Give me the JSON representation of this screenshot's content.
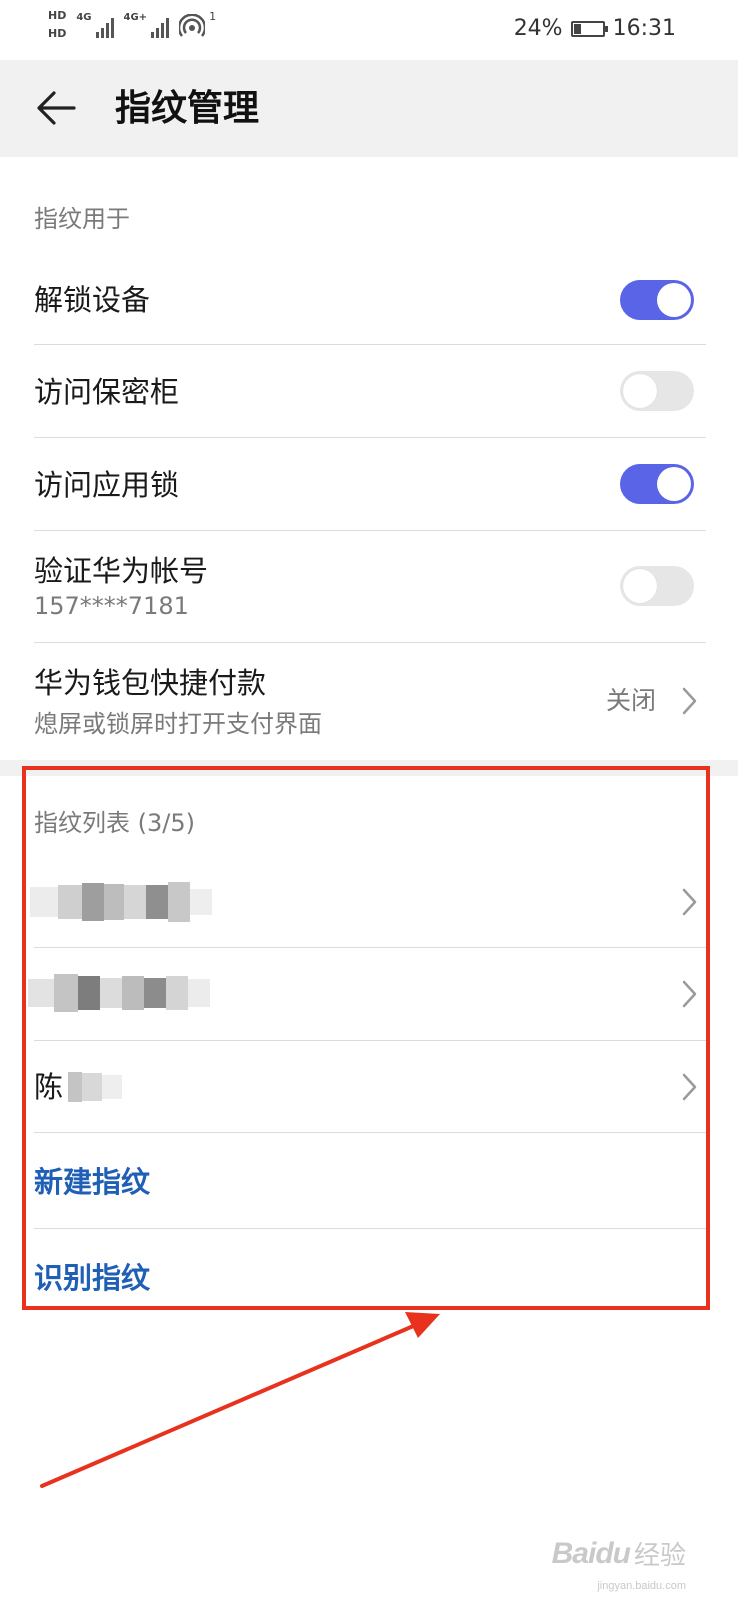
{
  "status_bar": {
    "hd1": "HD",
    "hd2": "HD",
    "net1": "4G",
    "net2": "4G+",
    "wifi_sup": "1",
    "battery": "24%",
    "time": "16:31"
  },
  "header": {
    "title": "指纹管理"
  },
  "usage_section": {
    "header": "指纹用于",
    "items": [
      {
        "label": "解锁设备",
        "toggle": "on"
      },
      {
        "label": "访问保密柜",
        "toggle": "off"
      },
      {
        "label": "访问应用锁",
        "toggle": "on"
      },
      {
        "label": "验证华为帐号",
        "sub": "157****7181",
        "toggle": "off"
      },
      {
        "label": "华为钱包快捷付款",
        "sub": "熄屏或锁屏时打开支付界面",
        "value": "关闭"
      }
    ]
  },
  "fingerprint_section": {
    "header": "指纹列表 (3/5)",
    "items": [
      {
        "label": ""
      },
      {
        "label": ""
      },
      {
        "label": "陈"
      }
    ],
    "new_label": "新建指纹",
    "identify_label": "识别指纹"
  },
  "colors": {
    "toggle_on": "#5a64e6",
    "toggle_off": "#e6e6e6",
    "action_text": "#1f5fb5",
    "annotation": "#e8321d"
  },
  "watermark": {
    "logo": "Baidu",
    "cn": "经验",
    "url": "jingyan.baidu.com"
  }
}
